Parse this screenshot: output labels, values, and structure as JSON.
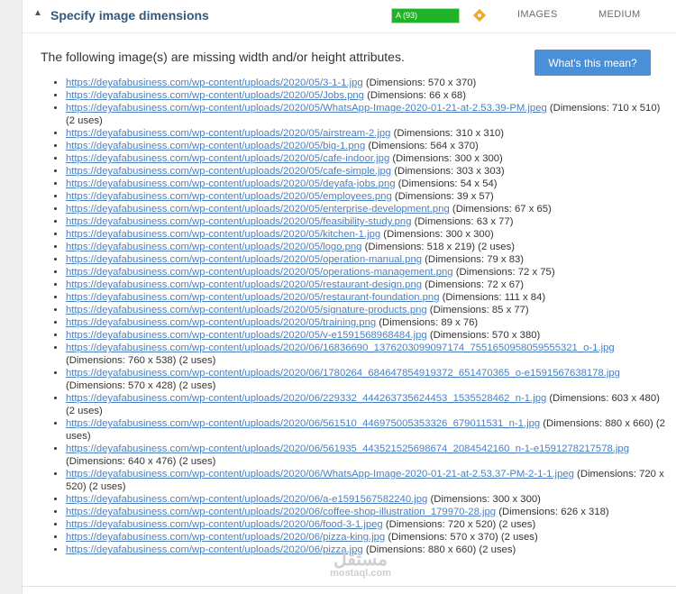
{
  "header": {
    "caret": "▲",
    "title": "Specify image dimensions",
    "grade": "A (93)",
    "type": "IMAGES",
    "priority": "MEDIUM",
    "grade_color": "#1fb327",
    "alert_color": "#f0a92b"
  },
  "content": {
    "intro": "The following image(s) are missing width and/or height attributes.",
    "help_button": "What's this mean?"
  },
  "items": [
    {
      "url": "https://deyafabusiness.com/wp-content/uploads/2020/05/3-1-1.jpg",
      "info": " (Dimensions: 570 x 370)"
    },
    {
      "url": "https://deyafabusiness.com/wp-content/uploads/2020/05/Jobs.png",
      "info": " (Dimensions: 66 x 68)"
    },
    {
      "url": "https://deyafabusiness.com/wp-content/uploads/2020/05/WhatsApp-Image-2020-01-21-at-2.53.39-PM.jpeg",
      "info": " (Dimensions: 710 x 510) (2 uses)"
    },
    {
      "url": "https://deyafabusiness.com/wp-content/uploads/2020/05/airstream-2.jpg",
      "info": " (Dimensions: 310 x 310)"
    },
    {
      "url": "https://deyafabusiness.com/wp-content/uploads/2020/05/big-1.png",
      "info": " (Dimensions: 564 x 370)"
    },
    {
      "url": "https://deyafabusiness.com/wp-content/uploads/2020/05/cafe-indoor.jpg",
      "info": " (Dimensions: 300 x 300)"
    },
    {
      "url": "https://deyafabusiness.com/wp-content/uploads/2020/05/cafe-simple.jpg",
      "info": " (Dimensions: 303 x 303)"
    },
    {
      "url": "https://deyafabusiness.com/wp-content/uploads/2020/05/deyafa-jobs.png",
      "info": " (Dimensions: 54 x 54)"
    },
    {
      "url": "https://deyafabusiness.com/wp-content/uploads/2020/05/employees.png",
      "info": " (Dimensions: 39 x 57)"
    },
    {
      "url": "https://deyafabusiness.com/wp-content/uploads/2020/05/enterprise-development.png",
      "info": " (Dimensions: 67 x 65)"
    },
    {
      "url": "https://deyafabusiness.com/wp-content/uploads/2020/05/feasibility-study.png",
      "info": " (Dimensions: 63 x 77)"
    },
    {
      "url": "https://deyafabusiness.com/wp-content/uploads/2020/05/kitchen-1.jpg",
      "info": " (Dimensions: 300 x 300)"
    },
    {
      "url": "https://deyafabusiness.com/wp-content/uploads/2020/05/logo.png",
      "info": " (Dimensions: 518 x 219) (2 uses)"
    },
    {
      "url": "https://deyafabusiness.com/wp-content/uploads/2020/05/operation-manual.png",
      "info": " (Dimensions: 79 x 83)"
    },
    {
      "url": "https://deyafabusiness.com/wp-content/uploads/2020/05/operations-management.png",
      "info": " (Dimensions: 72 x 75)"
    },
    {
      "url": "https://deyafabusiness.com/wp-content/uploads/2020/05/restaurant-design.png",
      "info": " (Dimensions: 72 x 67)"
    },
    {
      "url": "https://deyafabusiness.com/wp-content/uploads/2020/05/restaurant-foundation.png",
      "info": " (Dimensions: 111 x 84)"
    },
    {
      "url": "https://deyafabusiness.com/wp-content/uploads/2020/05/signature-products.png",
      "info": " (Dimensions: 85 x 77)"
    },
    {
      "url": "https://deyafabusiness.com/wp-content/uploads/2020/05/training.png",
      "info": " (Dimensions: 89 x 76)"
    },
    {
      "url": "https://deyafabusiness.com/wp-content/uploads/2020/05/v-e1591568968484.jpg",
      "info": " (Dimensions: 570 x 380)"
    },
    {
      "url": "https://deyafabusiness.com/wp-content/uploads/2020/06/16836690_1376203099097174_7551650958059555321_o-1.jpg",
      "info": " (Dimensions: 760 x 538) (2 uses)"
    },
    {
      "url": "https://deyafabusiness.com/wp-content/uploads/2020/06/1780264_684647854919372_651470365_o-e1591567638178.jpg",
      "info": " (Dimensions: 570 x 428) (2 uses)"
    },
    {
      "url": "https://deyafabusiness.com/wp-content/uploads/2020/06/229332_444263735624453_1535528462_n-1.jpg",
      "info": " (Dimensions: 603 x 480) (2 uses)"
    },
    {
      "url": "https://deyafabusiness.com/wp-content/uploads/2020/06/561510_446975005353326_679011531_n-1.jpg",
      "info": " (Dimensions: 880 x 660) (2 uses)"
    },
    {
      "url": "https://deyafabusiness.com/wp-content/uploads/2020/06/561935_443521525698674_2084542160_n-1-e1591278217578.jpg",
      "info": " (Dimensions: 640 x 476) (2 uses)"
    },
    {
      "url": "https://deyafabusiness.com/wp-content/uploads/2020/06/WhatsApp-Image-2020-01-21-at-2.53.37-PM-2-1-1.jpeg",
      "info": " (Dimensions: 720 x 520) (2 uses)"
    },
    {
      "url": "https://deyafabusiness.com/wp-content/uploads/2020/06/a-e1591567582240.jpg",
      "info": " (Dimensions: 300 x 300)"
    },
    {
      "url": "https://deyafabusiness.com/wp-content/uploads/2020/06/coffee-shop-illustration_179970-28.jpg",
      "info": " (Dimensions: 626 x 318)"
    },
    {
      "url": "https://deyafabusiness.com/wp-content/uploads/2020/06/food-3-1.jpeg",
      "info": " (Dimensions: 720 x 520) (2 uses)"
    },
    {
      "url": "https://deyafabusiness.com/wp-content/uploads/2020/06/pizza-king.jpg",
      "info": " (Dimensions: 570 x 370) (2 uses)"
    },
    {
      "url": "https://deyafabusiness.com/wp-content/uploads/2020/06/pizza.jpg",
      "info": " (Dimensions: 880 x 660) (2 uses)"
    }
  ],
  "watermark": {
    "arabic": "مستقل",
    "latin": "mostaql.com"
  }
}
